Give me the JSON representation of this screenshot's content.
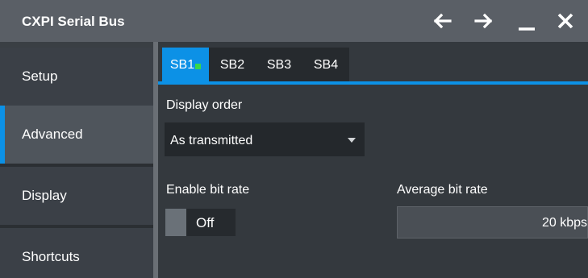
{
  "window": {
    "title": "CXPI Serial Bus"
  },
  "sidebar": {
    "items": [
      {
        "label": "Setup"
      },
      {
        "label": "Advanced"
      },
      {
        "label": "Display"
      },
      {
        "label": "Shortcuts"
      }
    ],
    "active": "Advanced"
  },
  "tabs": [
    {
      "label": "SB1"
    },
    {
      "label": "SB2"
    },
    {
      "label": "SB3"
    },
    {
      "label": "SB4"
    }
  ],
  "content": {
    "display_order": {
      "label": "Display order",
      "value": "As transmitted"
    },
    "enable_bit_rate": {
      "label": "Enable bit rate",
      "value": "Off"
    },
    "average_bit_rate": {
      "label": "Average bit rate",
      "value": "20 kbps"
    }
  },
  "colors": {
    "accent": "#0c91e6",
    "status_indicator": "#38d84a",
    "titlebar": "#5a5f66"
  },
  "icons": [
    "arrow-left-icon",
    "arrow-right-icon",
    "minimize-icon",
    "close-icon",
    "chevron-down-icon"
  ]
}
